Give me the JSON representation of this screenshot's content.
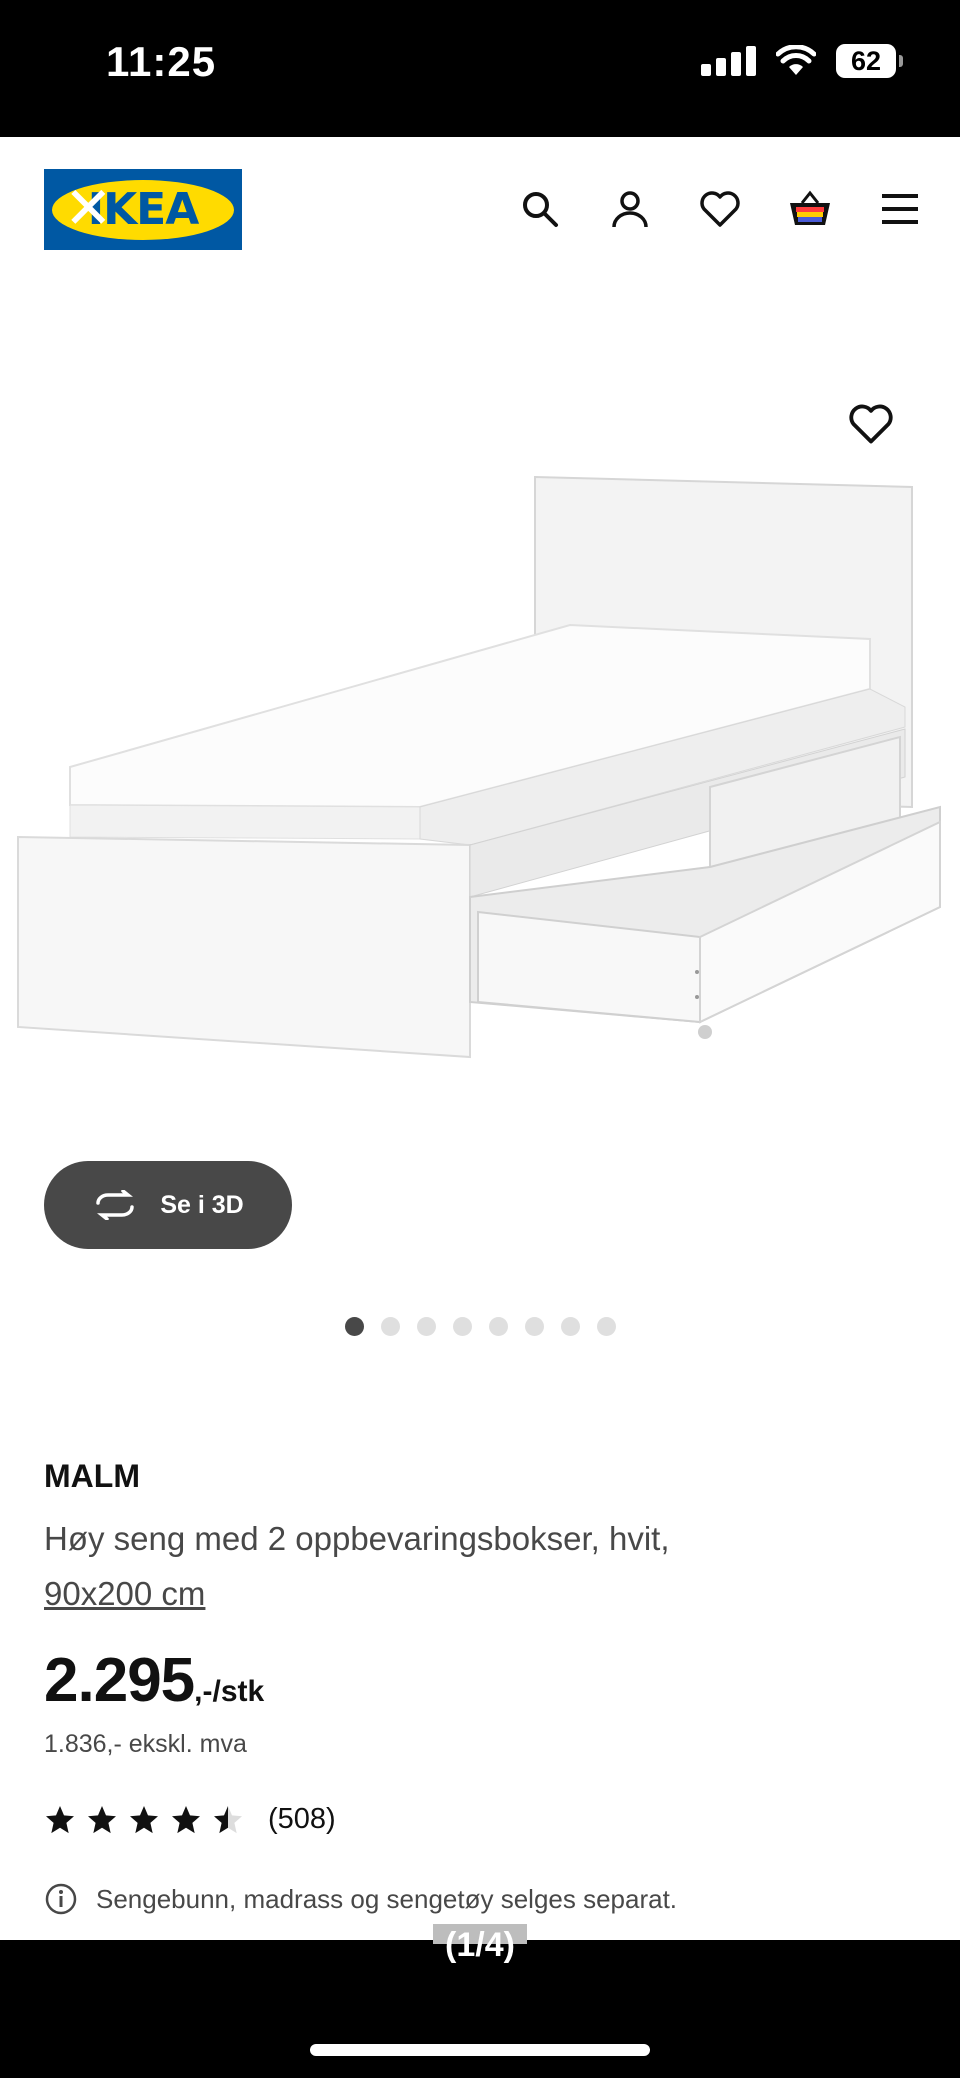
{
  "status_bar": {
    "time": "11:25",
    "battery": "62"
  },
  "header": {
    "logo_text": "IKEA",
    "icons": [
      "search-icon",
      "account-icon",
      "wishlist-icon",
      "cart-icon",
      "menu-icon"
    ]
  },
  "gallery": {
    "view_3d_label": "Se i 3D",
    "image_count": 8,
    "active_index": 0
  },
  "product": {
    "brand": "MALM",
    "description": "Høy seng med 2 oppbevaringsbokser, hvit,",
    "dimensions": "90x200 cm",
    "price_integer": "2.295",
    "price_suffix": ",-/stk",
    "price_ex_vat": "1.836,- ekskl. mva",
    "rating_value": 4.5,
    "review_count": "(508)",
    "notice": "Sengebunn, madrass og sengetøy selges separat."
  },
  "overlay": {
    "page_indicator": "(1/4)"
  },
  "colors": {
    "ikea_blue": "#0058a3",
    "ikea_yellow": "#ffdb00",
    "button_dark": "#484848"
  }
}
